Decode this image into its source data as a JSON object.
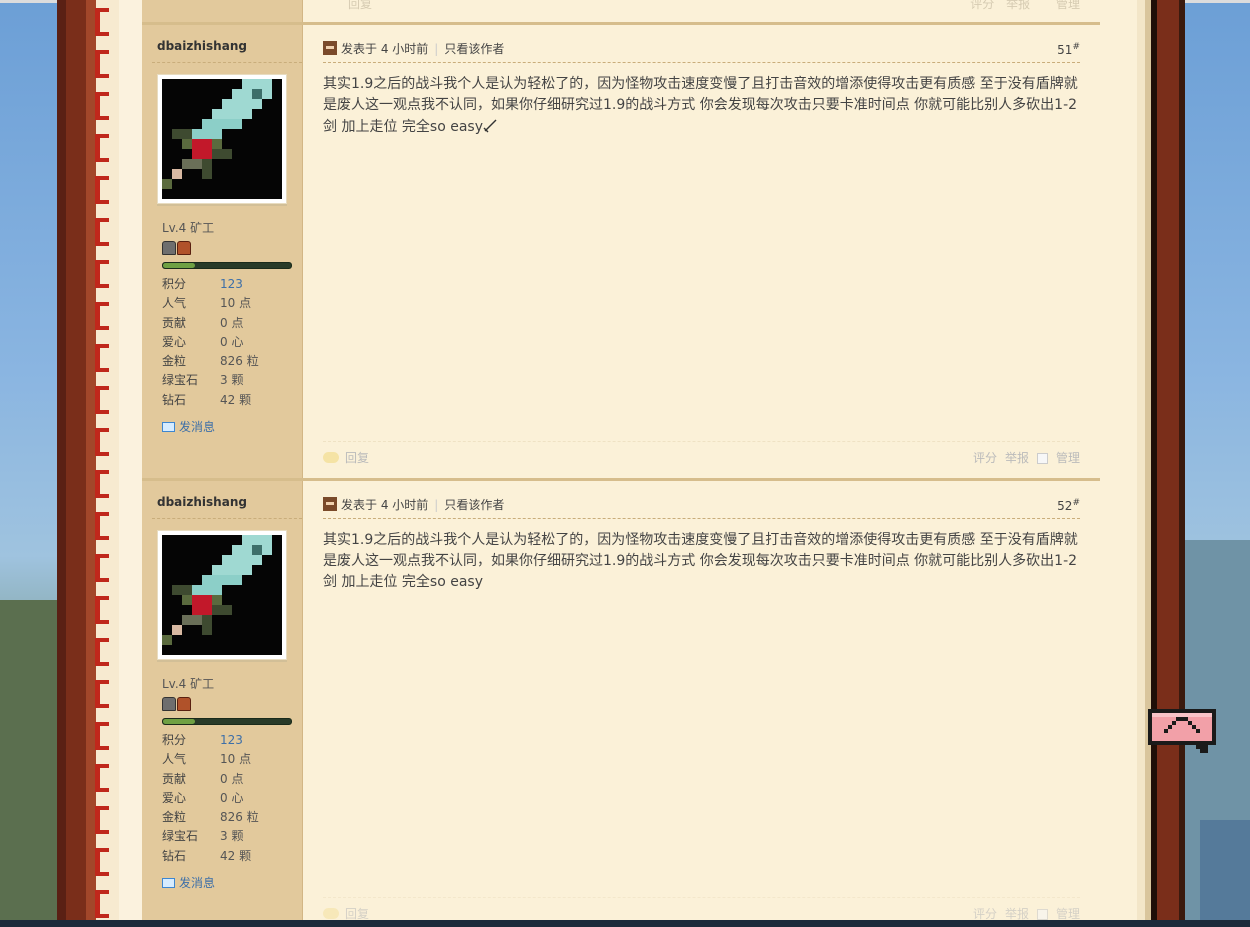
{
  "ghost_footer": {
    "reply": "回复",
    "rate": "评分",
    "report": "举报",
    "manage": "管理"
  },
  "posts": [
    {
      "author": "dbaizhishang",
      "level": "Lv.4 矿工",
      "stats": [
        {
          "label": "积分",
          "value": "123"
        },
        {
          "label": "人气",
          "value": "10 点"
        },
        {
          "label": "贡献",
          "value": "0 点"
        },
        {
          "label": "爱心",
          "value": "0 心"
        },
        {
          "label": "金粒",
          "value": "826 粒"
        },
        {
          "label": "绿宝石",
          "value": "3 颗"
        },
        {
          "label": "钻石",
          "value": "42 颗"
        }
      ],
      "send_message": "发消息",
      "posted": "发表于 4 小时前",
      "only_author": "只看该作者",
      "floor": "51",
      "floor_mark": "#",
      "body": "其实1.9之后的战斗我个人是认为轻松了的，因为怪物攻击速度变慢了且打击音效的增添使得攻击更有质感 至于没有盾牌就是废人这一观点我不认同，如果你仔细研究过1.9的战斗方式 你会发现每次攻击只要卡准时间点 你就可能比别人多砍出1-2剑 加上走位 完全so easy",
      "reply": "回复",
      "rate": "评分",
      "report": "举报",
      "manage": "管理",
      "progress": 0.25
    },
    {
      "author": "dbaizhishang",
      "level": "Lv.4 矿工",
      "stats": [
        {
          "label": "积分",
          "value": "123"
        },
        {
          "label": "人气",
          "value": "10 点"
        },
        {
          "label": "贡献",
          "value": "0 点"
        },
        {
          "label": "爱心",
          "value": "0 心"
        },
        {
          "label": "金粒",
          "value": "826 粒"
        },
        {
          "label": "绿宝石",
          "value": "3 颗"
        },
        {
          "label": "钻石",
          "value": "42 颗"
        }
      ],
      "send_message": "发消息",
      "posted": "发表于 4 小时前",
      "only_author": "只看该作者",
      "floor": "52",
      "floor_mark": "#",
      "body": "其实1.9之后的战斗我个人是认为轻松了的，因为怪物攻击速度变慢了且打击音效的增添使得攻击更有质感 至于没有盾牌就是废人这一观点我不认同，如果你仔细研究过1.9的战斗方式 你会发现每次攻击只要卡准时间点 你就可能比别人多砍出1-2剑 加上走位 完全so easy",
      "reply": "回复",
      "rate": "评分",
      "report": "举报",
      "manage": "管理",
      "progress": 0.25
    }
  ],
  "colors": {
    "accent_link": "#3d6fa8",
    "sidebar_bg": "#e2c99c",
    "content_bg": "#fbf1d8",
    "chain_red": "#c0271b"
  }
}
